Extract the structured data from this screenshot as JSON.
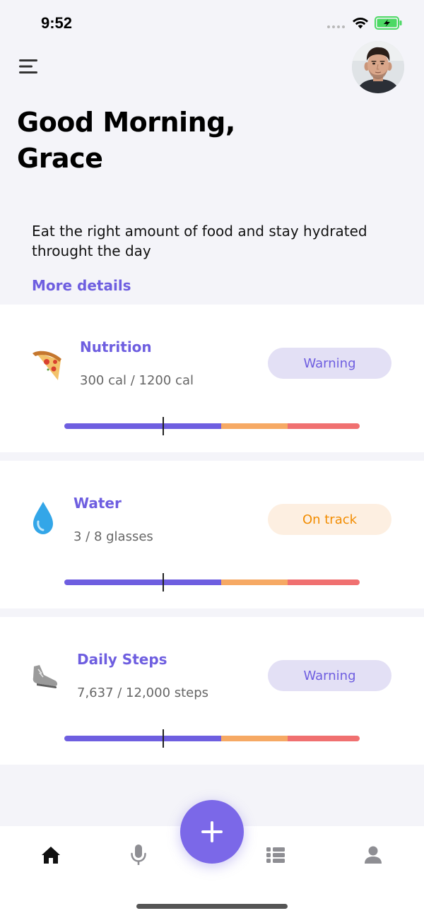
{
  "status_bar": {
    "time": "9:52"
  },
  "header": {
    "greeting": "Good Morning,\nGrace",
    "tagline": "Eat the right amount of food and stay hydrated throught the day",
    "more_details": "More details"
  },
  "cards": [
    {
      "title": "Nutrition",
      "subtitle": "300 cal / 1200 cal",
      "status": "Warning",
      "icon": "pizza-icon"
    },
    {
      "title": "Water",
      "subtitle": "3 / 8 glasses",
      "status": "On track",
      "icon": "water-drop-icon"
    },
    {
      "title": "Daily Steps",
      "subtitle": "7,637 / 12,000 steps",
      "status": "Warning",
      "icon": "sneaker-icon"
    }
  ],
  "colors": {
    "accent": "#6e5ee0",
    "warning_pill_bg": "#e3e0f5",
    "ontrack_pill_bg": "#fdefe1",
    "ontrack_text": "#f28c00",
    "progress_orange": "#f6a964",
    "progress_red": "#f07070"
  },
  "bottom_nav": {
    "items": [
      "home-icon",
      "microphone-icon",
      "add-icon",
      "list-icon",
      "profile-icon"
    ]
  }
}
